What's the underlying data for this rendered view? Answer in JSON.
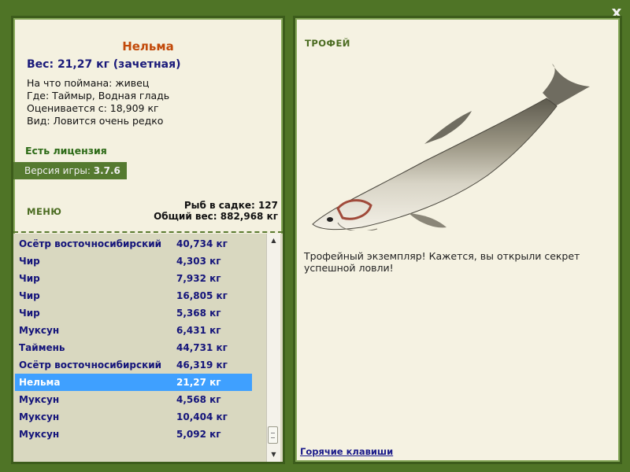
{
  "close_label": "x",
  "fish": {
    "name": "Нельма",
    "weight": "Вес: 21,27 кг (зачетная)",
    "caught_with": "На что поймана: живец",
    "where": "Где: Таймыр, Водная гладь",
    "valued_from": "Оценивается с: 18,909 кг",
    "kind": "Вид: Ловится очень редко"
  },
  "license": "Есть лицензия",
  "version": {
    "label": "Версия игры:",
    "value": "3.7.6"
  },
  "menu_label": "МЕНЮ",
  "cage": {
    "count": "Рыб в садке: 127",
    "total_weight": "Общий вес: 882,968 кг"
  },
  "list": {
    "rows": [
      {
        "name": "Осётр восточносибирский",
        "weight": "40,734 кг"
      },
      {
        "name": "Чир",
        "weight": "4,303 кг"
      },
      {
        "name": "Чир",
        "weight": "7,932 кг"
      },
      {
        "name": "Чир",
        "weight": "16,805 кг"
      },
      {
        "name": "Чир",
        "weight": "5,368 кг"
      },
      {
        "name": "Муксун",
        "weight": "6,431 кг"
      },
      {
        "name": "Таймень",
        "weight": "44,731 кг"
      },
      {
        "name": "Осётр восточносибирский",
        "weight": "46,319 кг"
      },
      {
        "name": "Нельма",
        "weight": "21,27 кг"
      },
      {
        "name": "Муксун",
        "weight": "4,568 кг"
      },
      {
        "name": "Муксун",
        "weight": "10,404 кг"
      },
      {
        "name": "Муксун",
        "weight": "5,092 кг"
      }
    ],
    "selected_index": 8
  },
  "trophy": {
    "label": "ТРОФЕЙ",
    "text": "Трофейный экземпляр! Кажется, вы открыли секрет успешной ловли!"
  },
  "hotkeys_label": "Горячие клавиши",
  "colors": {
    "background": "#4f7426",
    "selection": "#3fa0ff",
    "fish_name": "#c24a0a",
    "list_text": "#14147a"
  }
}
